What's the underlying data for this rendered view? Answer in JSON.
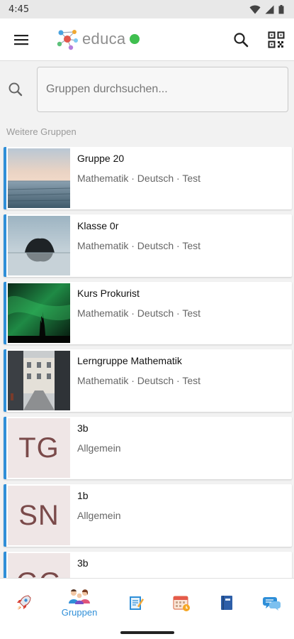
{
  "status_bar": {
    "time": "4:45"
  },
  "app_bar": {
    "logo_text": "educa",
    "brand_green": "#3fbf4f",
    "accent": "#2f8fd8"
  },
  "search": {
    "placeholder": "Gruppen durchsuchen..."
  },
  "section": {
    "label": "Weitere Gruppen"
  },
  "groups": [
    {
      "title": "Gruppe 20",
      "subtitle": "Mathematik · Deutsch · Test",
      "image": "sea-horizon"
    },
    {
      "title": "Klasse 0r",
      "subtitle": "Mathematik · Deutsch · Test",
      "image": "island-rock"
    },
    {
      "title": "Kurs Prokurist",
      "subtitle": "Mathematik · Deutsch · Test",
      "image": "northern-lights"
    },
    {
      "title": "Lerngruppe Mathematik",
      "subtitle": "Mathematik · Deutsch · Test",
      "image": "city-street"
    },
    {
      "title": "3b",
      "subtitle": "Allgemein",
      "initials": "TG"
    },
    {
      "title": "1b",
      "subtitle": "Allgemein",
      "initials": "SN"
    },
    {
      "title": "3b",
      "subtitle": "",
      "initials": "GG"
    }
  ],
  "bottom_nav": {
    "items": [
      {
        "icon": "rocket-icon"
      },
      {
        "icon": "people-icon",
        "label": "Gruppen",
        "active": true
      },
      {
        "icon": "notepad-icon"
      },
      {
        "icon": "calendar-icon"
      },
      {
        "icon": "notebook-icon"
      },
      {
        "icon": "chat-icon"
      }
    ]
  }
}
